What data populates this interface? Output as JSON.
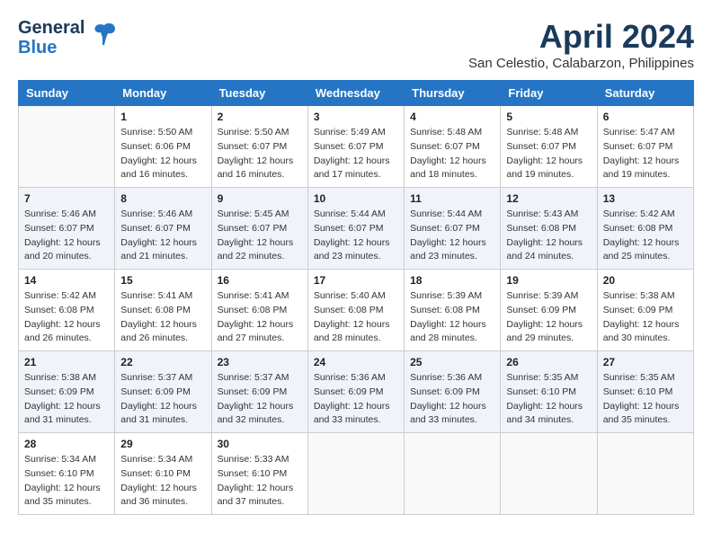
{
  "header": {
    "logo_line1": "General",
    "logo_line2": "Blue",
    "month": "April 2024",
    "location": "San Celestio, Calabarzon, Philippines"
  },
  "days_of_week": [
    "Sunday",
    "Monday",
    "Tuesday",
    "Wednesday",
    "Thursday",
    "Friday",
    "Saturday"
  ],
  "weeks": [
    [
      {
        "day": "",
        "info": ""
      },
      {
        "day": "1",
        "info": "Sunrise: 5:50 AM\nSunset: 6:06 PM\nDaylight: 12 hours\nand 16 minutes."
      },
      {
        "day": "2",
        "info": "Sunrise: 5:50 AM\nSunset: 6:07 PM\nDaylight: 12 hours\nand 16 minutes."
      },
      {
        "day": "3",
        "info": "Sunrise: 5:49 AM\nSunset: 6:07 PM\nDaylight: 12 hours\nand 17 minutes."
      },
      {
        "day": "4",
        "info": "Sunrise: 5:48 AM\nSunset: 6:07 PM\nDaylight: 12 hours\nand 18 minutes."
      },
      {
        "day": "5",
        "info": "Sunrise: 5:48 AM\nSunset: 6:07 PM\nDaylight: 12 hours\nand 19 minutes."
      },
      {
        "day": "6",
        "info": "Sunrise: 5:47 AM\nSunset: 6:07 PM\nDaylight: 12 hours\nand 19 minutes."
      }
    ],
    [
      {
        "day": "7",
        "info": "Sunrise: 5:46 AM\nSunset: 6:07 PM\nDaylight: 12 hours\nand 20 minutes."
      },
      {
        "day": "8",
        "info": "Sunrise: 5:46 AM\nSunset: 6:07 PM\nDaylight: 12 hours\nand 21 minutes."
      },
      {
        "day": "9",
        "info": "Sunrise: 5:45 AM\nSunset: 6:07 PM\nDaylight: 12 hours\nand 22 minutes."
      },
      {
        "day": "10",
        "info": "Sunrise: 5:44 AM\nSunset: 6:07 PM\nDaylight: 12 hours\nand 23 minutes."
      },
      {
        "day": "11",
        "info": "Sunrise: 5:44 AM\nSunset: 6:07 PM\nDaylight: 12 hours\nand 23 minutes."
      },
      {
        "day": "12",
        "info": "Sunrise: 5:43 AM\nSunset: 6:08 PM\nDaylight: 12 hours\nand 24 minutes."
      },
      {
        "day": "13",
        "info": "Sunrise: 5:42 AM\nSunset: 6:08 PM\nDaylight: 12 hours\nand 25 minutes."
      }
    ],
    [
      {
        "day": "14",
        "info": "Sunrise: 5:42 AM\nSunset: 6:08 PM\nDaylight: 12 hours\nand 26 minutes."
      },
      {
        "day": "15",
        "info": "Sunrise: 5:41 AM\nSunset: 6:08 PM\nDaylight: 12 hours\nand 26 minutes."
      },
      {
        "day": "16",
        "info": "Sunrise: 5:41 AM\nSunset: 6:08 PM\nDaylight: 12 hours\nand 27 minutes."
      },
      {
        "day": "17",
        "info": "Sunrise: 5:40 AM\nSunset: 6:08 PM\nDaylight: 12 hours\nand 28 minutes."
      },
      {
        "day": "18",
        "info": "Sunrise: 5:39 AM\nSunset: 6:08 PM\nDaylight: 12 hours\nand 28 minutes."
      },
      {
        "day": "19",
        "info": "Sunrise: 5:39 AM\nSunset: 6:09 PM\nDaylight: 12 hours\nand 29 minutes."
      },
      {
        "day": "20",
        "info": "Sunrise: 5:38 AM\nSunset: 6:09 PM\nDaylight: 12 hours\nand 30 minutes."
      }
    ],
    [
      {
        "day": "21",
        "info": "Sunrise: 5:38 AM\nSunset: 6:09 PM\nDaylight: 12 hours\nand 31 minutes."
      },
      {
        "day": "22",
        "info": "Sunrise: 5:37 AM\nSunset: 6:09 PM\nDaylight: 12 hours\nand 31 minutes."
      },
      {
        "day": "23",
        "info": "Sunrise: 5:37 AM\nSunset: 6:09 PM\nDaylight: 12 hours\nand 32 minutes."
      },
      {
        "day": "24",
        "info": "Sunrise: 5:36 AM\nSunset: 6:09 PM\nDaylight: 12 hours\nand 33 minutes."
      },
      {
        "day": "25",
        "info": "Sunrise: 5:36 AM\nSunset: 6:09 PM\nDaylight: 12 hours\nand 33 minutes."
      },
      {
        "day": "26",
        "info": "Sunrise: 5:35 AM\nSunset: 6:10 PM\nDaylight: 12 hours\nand 34 minutes."
      },
      {
        "day": "27",
        "info": "Sunrise: 5:35 AM\nSunset: 6:10 PM\nDaylight: 12 hours\nand 35 minutes."
      }
    ],
    [
      {
        "day": "28",
        "info": "Sunrise: 5:34 AM\nSunset: 6:10 PM\nDaylight: 12 hours\nand 35 minutes."
      },
      {
        "day": "29",
        "info": "Sunrise: 5:34 AM\nSunset: 6:10 PM\nDaylight: 12 hours\nand 36 minutes."
      },
      {
        "day": "30",
        "info": "Sunrise: 5:33 AM\nSunset: 6:10 PM\nDaylight: 12 hours\nand 37 minutes."
      },
      {
        "day": "",
        "info": ""
      },
      {
        "day": "",
        "info": ""
      },
      {
        "day": "",
        "info": ""
      },
      {
        "day": "",
        "info": ""
      }
    ]
  ]
}
